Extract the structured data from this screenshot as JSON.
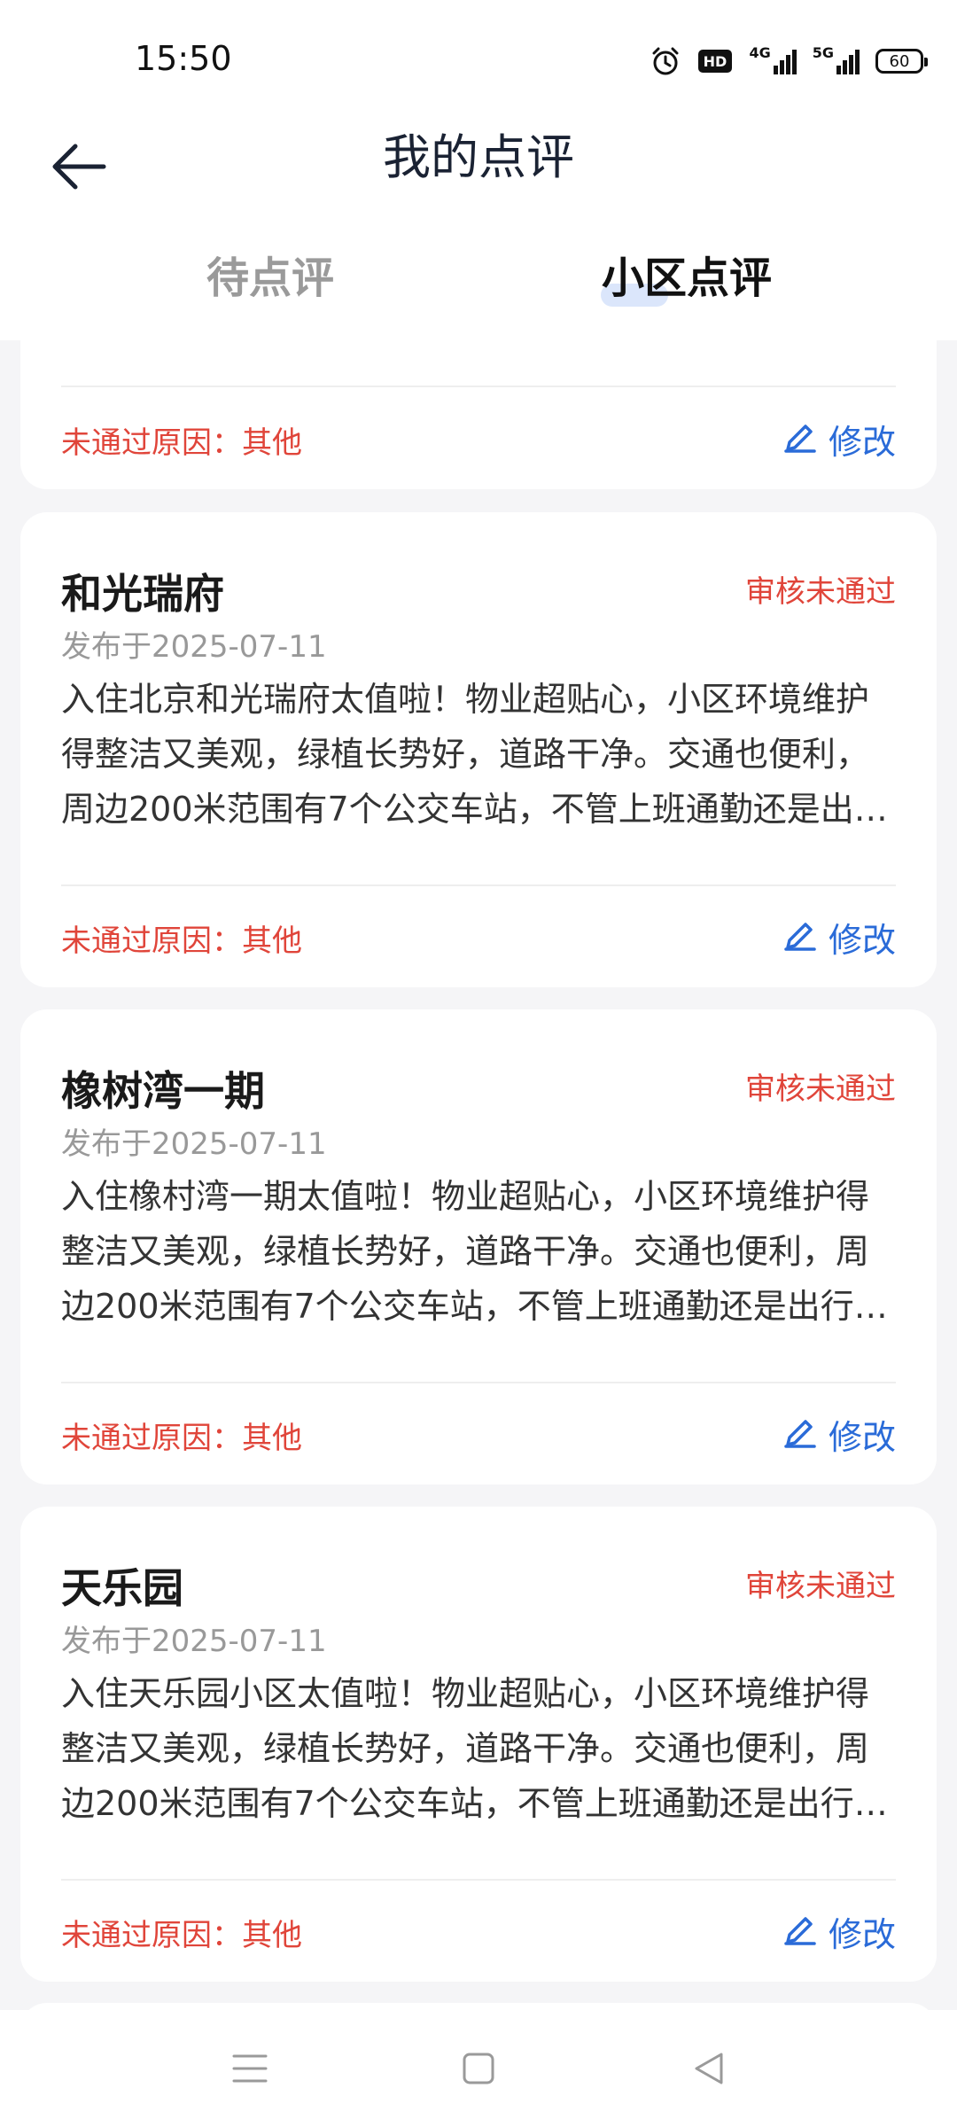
{
  "status_bar": {
    "time": "15:50",
    "net1": "4G",
    "net2": "5G",
    "battery": "60"
  },
  "header": {
    "title": "我的点评"
  },
  "tabs": [
    {
      "label": "待点评"
    },
    {
      "label": "小区点评"
    }
  ],
  "edit_label": "修改",
  "reason_label": "未通过原因：其他",
  "partial_card": {
    "reason": "未通过原因：其他",
    "edit": "修改"
  },
  "reviews": [
    {
      "title": "和光瑞府",
      "status": "审核未通过",
      "date": "发布于2025-07-11",
      "body": "入住北京和光瑞府太值啦！物业超贴心，小区环境维护得整洁又美观，绿植长势好，道路干净。交通也便利，周边200米范围有7个公交车站，不管上班通勤还是出行都很方便。",
      "reason": "未通过原因：其他",
      "edit": "修改"
    },
    {
      "title": "橡树湾一期",
      "status": "审核未通过",
      "date": "发布于2025-07-11",
      "body": "入住橡村湾一期太值啦！物业超贴心，小区环境维护得整洁又美观，绿植长势好，道路干净。交通也便利，周边200米范围有7个公交车站，不管上班通勤还是出行都很方便。",
      "reason": "未通过原因：其他",
      "edit": "修改"
    },
    {
      "title": "天乐园",
      "status": "审核未通过",
      "date": "发布于2025-07-11",
      "body": "入住天乐园小区太值啦！物业超贴心，小区环境维护得整洁又美观，绿植长势好，道路干净。交通也便利，周边200米范围有7个公交车站，不管上班通勤还是出行都很方便。",
      "reason": "未通过原因：其他",
      "edit": "修改"
    }
  ],
  "icons": {
    "back": "arrow-left-icon",
    "edit": "pencil-icon",
    "menu": "menu-icon",
    "home": "square-icon",
    "back_nav": "triangle-back-icon"
  },
  "colors": {
    "accent": "#2a6bd8",
    "rejected": "#e0453a",
    "background": "#f5f5f7"
  }
}
